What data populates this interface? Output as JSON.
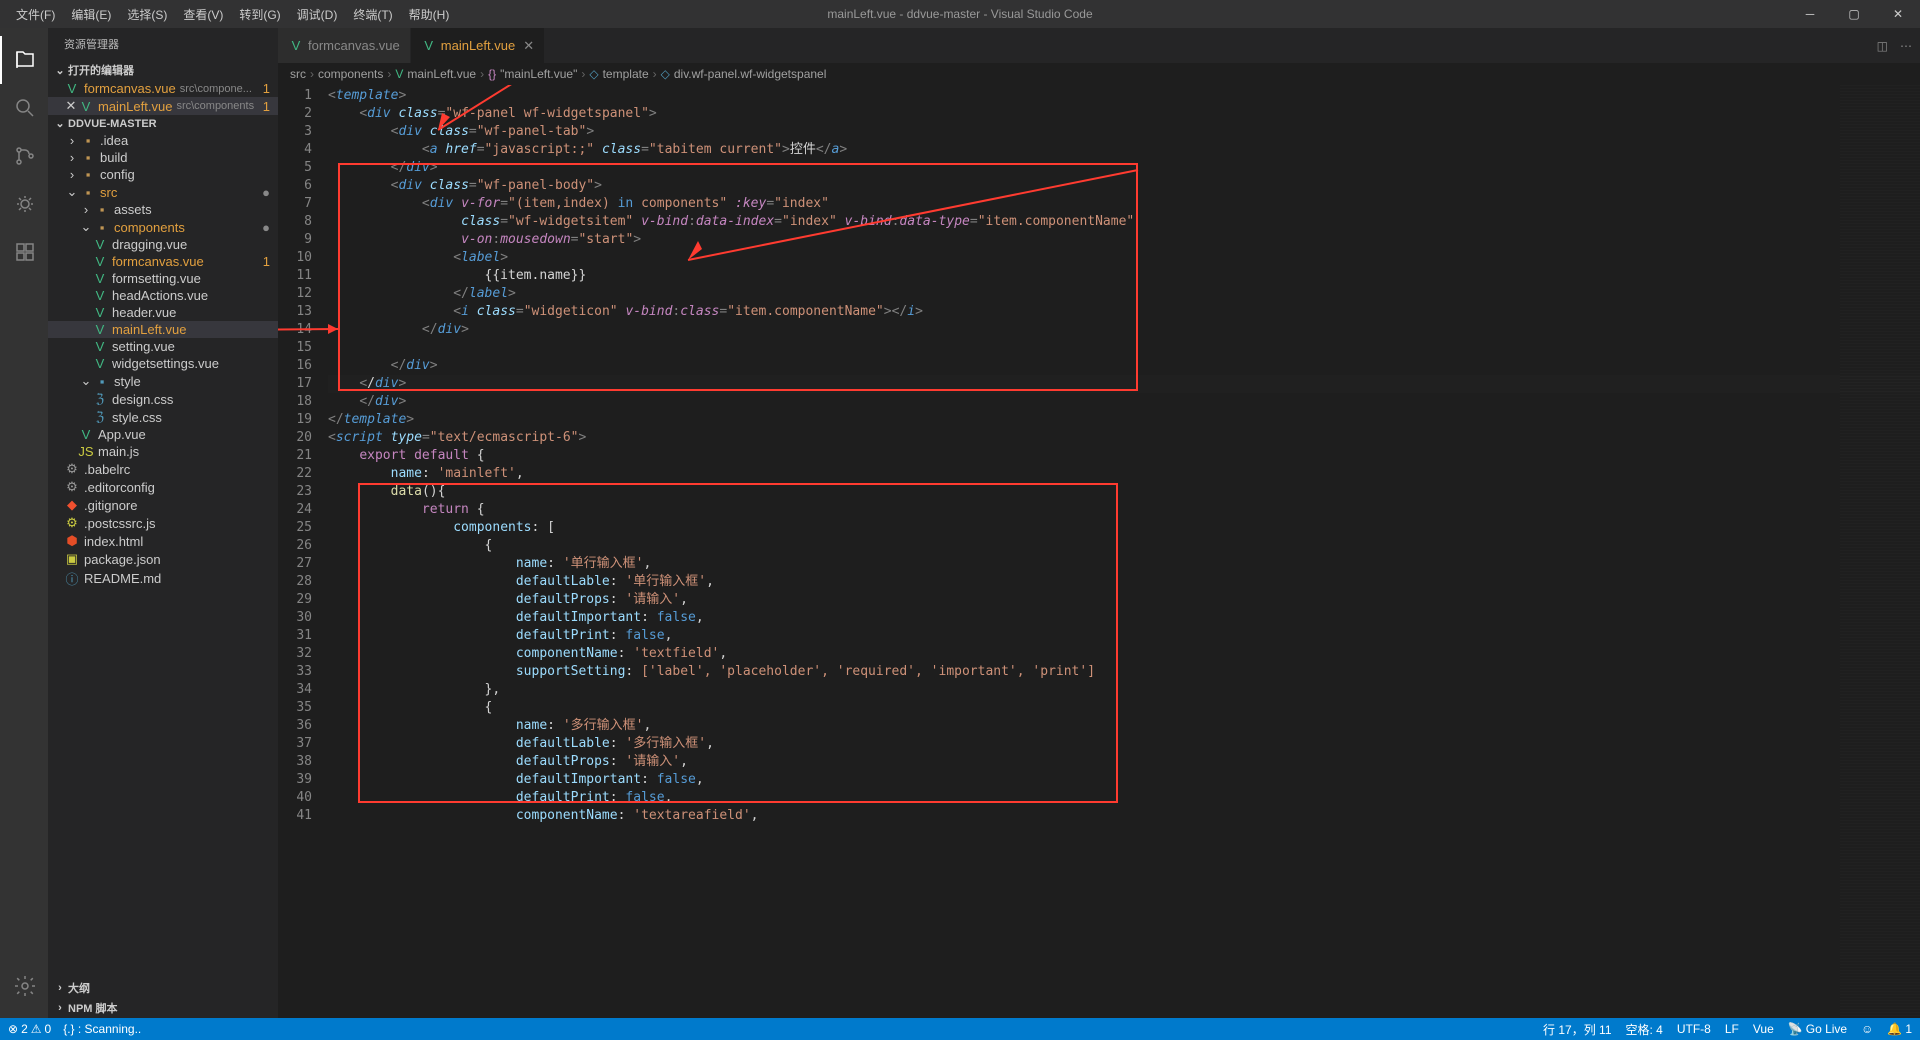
{
  "window": {
    "title": "mainLeft.vue - ddvue-master - Visual Studio Code"
  },
  "menu": {
    "file": "文件(F)",
    "edit": "编辑(E)",
    "select": "选择(S)",
    "view": "查看(V)",
    "goto": "转到(G)",
    "debug": "调试(D)",
    "terminal": "终端(T)",
    "help": "帮助(H)"
  },
  "sidebar": {
    "title": "资源管理器",
    "openEditors": "打开的编辑器",
    "project": "DDVUE-MASTER",
    "outline": "大纲",
    "npm": "NPM 脚本",
    "openFiles": [
      {
        "name": "formcanvas.vue",
        "path": "src\\compone...",
        "badge": "1"
      },
      {
        "name": "mainLeft.vue",
        "path": "src\\components",
        "badge": "1"
      }
    ],
    "tree": {
      "idea": ".idea",
      "build": "build",
      "config": "config",
      "src": "src",
      "assets": "assets",
      "components": "components",
      "dragging": "dragging.vue",
      "formcanvas": "formcanvas.vue",
      "formsetting": "formsetting.vue",
      "headActions": "headActions.vue",
      "header": "header.vue",
      "mainLeft": "mainLeft.vue",
      "setting": "setting.vue",
      "widgetsettings": "widgetsettings.vue",
      "style": "style",
      "designcss": "design.css",
      "stylecss": "style.css",
      "appvue": "App.vue",
      "mainjs": "main.js",
      "babelrc": ".babelrc",
      "editorconfig": ".editorconfig",
      "gitignore": ".gitignore",
      "postcss": ".postcssrc.js",
      "indexhtml": "index.html",
      "package": "package.json",
      "readme": "README.md"
    }
  },
  "tabs": {
    "formcanvas": "formcanvas.vue",
    "mainLeft": "mainLeft.vue"
  },
  "breadcrumbs": {
    "src": "src",
    "components": "components",
    "file": "mainLeft.vue",
    "braces": "\"mainLeft.vue\"",
    "template": "template",
    "div": "div.wf-panel.wf-widgetspanel"
  },
  "code": {
    "line_numbers": [
      "1",
      "2",
      "3",
      "4",
      "5",
      "6",
      "7",
      "8",
      "9",
      "10",
      "11",
      "12",
      "13",
      "14",
      "15",
      "16",
      "17",
      "18",
      "19",
      "20",
      "21",
      "22",
      "23",
      "24",
      "25",
      "26",
      "27",
      "28",
      "29",
      "30",
      "31",
      "32",
      "33",
      "34",
      "35",
      "36",
      "37",
      "38",
      "39",
      "40",
      "41"
    ],
    "l1": "<template>",
    "l2_cls": "wf-panel wf-widgetspanel",
    "l3_cls": "wf-panel-tab",
    "l4_href": "javascript:;",
    "l4_cls": "tabitem current",
    "l4_txt": "控件",
    "l6_cls": "wf-panel-body",
    "l7_vfor": "(item,index) in components",
    "l7_key": "index",
    "l8_cls": "wf-widgetsitem",
    "l8_di": "index",
    "l8_dt": "item.componentName",
    "l9_ev": "start",
    "l11_expr": "{{item.name}}",
    "l13_cls": "widgeticon",
    "l13_bind": "item.componentName",
    "l20_type": "text/ecmascript-6",
    "l21_export": "export default",
    "l22_name": "mainleft",
    "l23_data": "data",
    "l24_return": "return",
    "l25_components": "components",
    "l27_name": "单行输入框",
    "l28_lbl": "单行输入框",
    "l29_props": "请输入",
    "l30_false": "false",
    "l31_false": "false",
    "l32_comp": "textfield",
    "l33_arr": "['label', 'placeholder', 'required', 'important', 'print']",
    "l36_name": "多行输入框",
    "l37_lbl": "多行输入框",
    "l38_props": "请输入",
    "l39_false": "false",
    "l40_false": "false",
    "l41_comp": "textareafield"
  },
  "status": {
    "errors": "2",
    "warnings": "0",
    "scanning": "{.} : Scanning..",
    "ln_col": "行 17，列 11",
    "spaces": "空格: 4",
    "encoding": "UTF-8",
    "eol": "LF",
    "lang": "Vue",
    "golive": "Go Live",
    "bell": "1"
  }
}
